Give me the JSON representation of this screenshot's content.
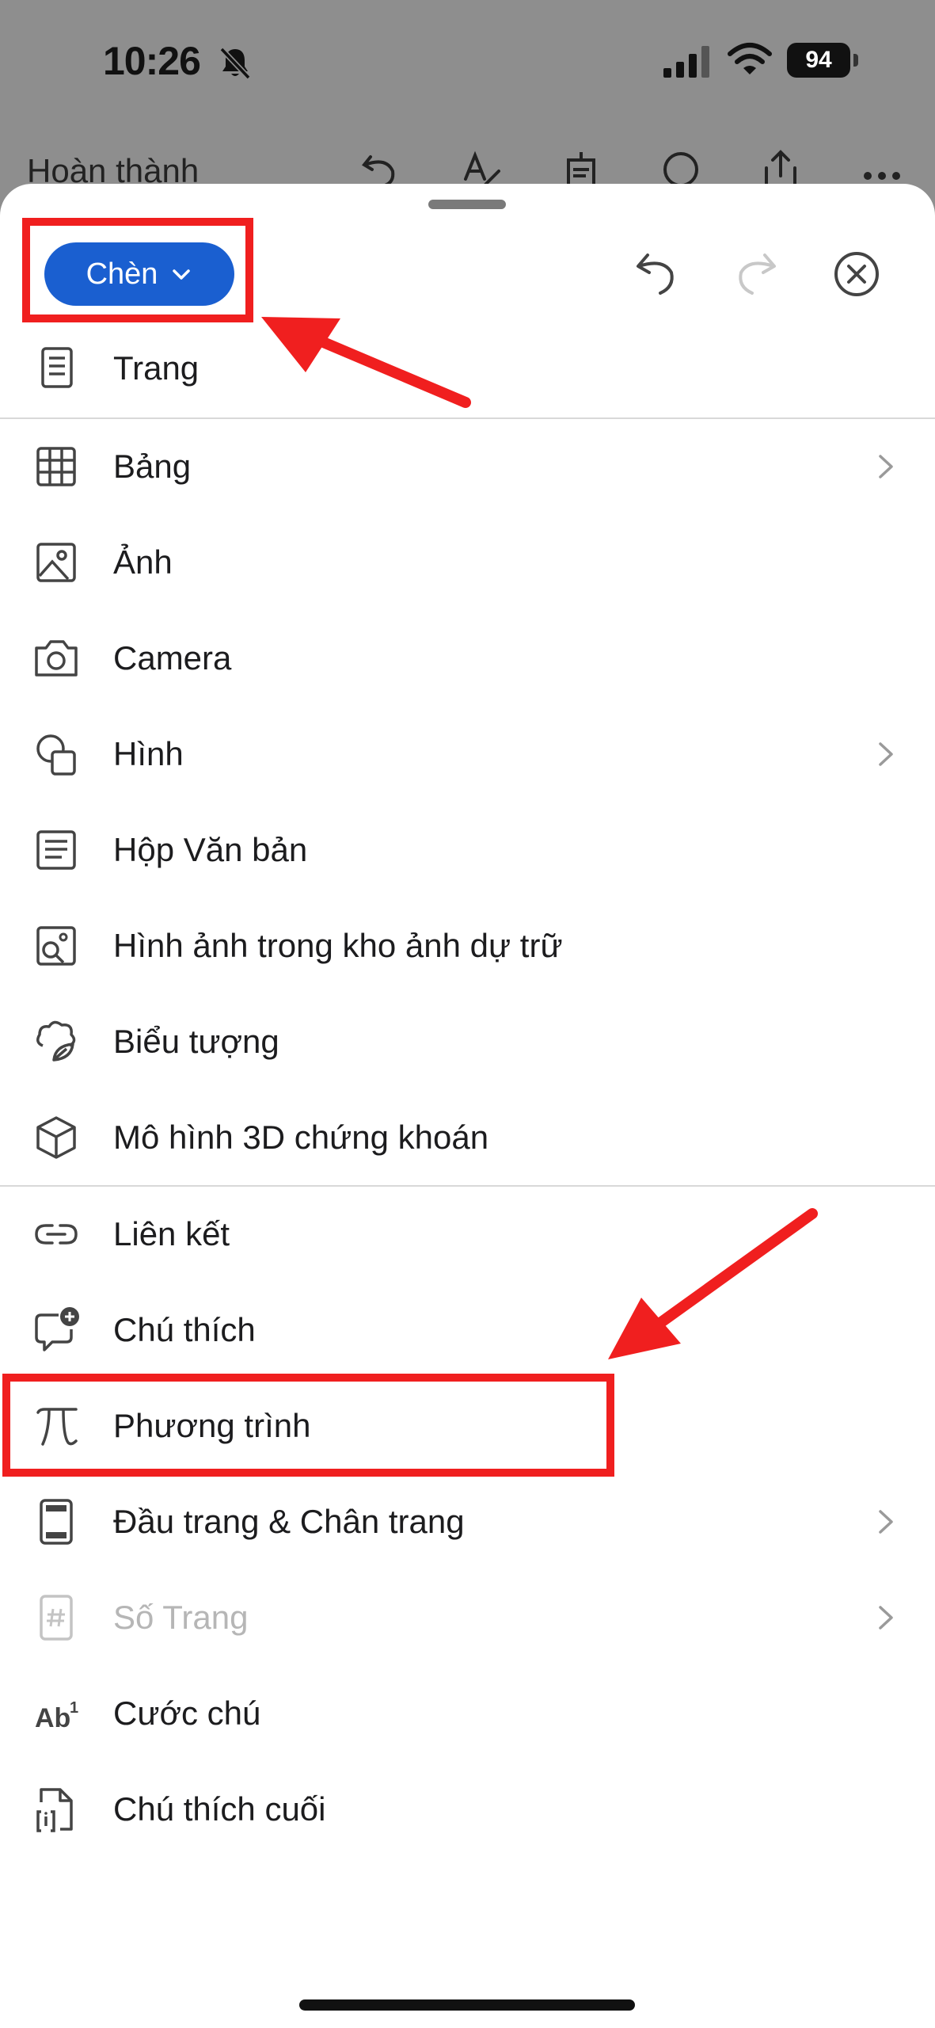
{
  "status_bar": {
    "time": "10:26",
    "battery": "94"
  },
  "background": {
    "done_label": "Hoàn thành"
  },
  "sheet": {
    "insert_label": "Chèn",
    "menu": [
      {
        "id": "page",
        "label": "Trang",
        "icon": "page-icon",
        "chevron": false
      },
      {
        "id": "table",
        "label": "Bảng",
        "icon": "table-icon",
        "chevron": true
      },
      {
        "id": "picture",
        "label": "Ảnh",
        "icon": "picture-icon",
        "chevron": false
      },
      {
        "id": "camera",
        "label": "Camera",
        "icon": "camera-icon",
        "chevron": false
      },
      {
        "id": "shape",
        "label": "Hình",
        "icon": "shape-icon",
        "chevron": true
      },
      {
        "id": "textbox",
        "label": "Hộp Văn bản",
        "icon": "textbox-icon",
        "chevron": false
      },
      {
        "id": "stock-images",
        "label": "Hình ảnh trong kho ảnh dự trữ",
        "icon": "stock-image-icon",
        "chevron": false
      },
      {
        "id": "icons",
        "label": "Biểu tượng",
        "icon": "icons-icon",
        "chevron": false
      },
      {
        "id": "3d-models",
        "label": "Mô hình 3D chứng khoán",
        "icon": "cube-icon",
        "chevron": false
      },
      {
        "id": "link",
        "label": "Liên kết",
        "icon": "link-icon",
        "chevron": false
      },
      {
        "id": "comment",
        "label": "Chú thích",
        "icon": "comment-add-icon",
        "chevron": false
      },
      {
        "id": "equation",
        "label": "Phương trình",
        "icon": "pi-icon",
        "chevron": false
      },
      {
        "id": "header-footer",
        "label": "Đầu trang & Chân trang",
        "icon": "header-footer-icon",
        "chevron": true
      },
      {
        "id": "page-number",
        "label": "Số Trang",
        "icon": "page-number-icon",
        "chevron": true,
        "disabled": true
      },
      {
        "id": "footnote",
        "label": "Cước chú",
        "icon": "footnote-icon",
        "chevron": false
      },
      {
        "id": "endnote",
        "label": "Chú thích cuối",
        "icon": "endnote-icon",
        "chevron": false
      }
    ]
  },
  "colors": {
    "accent": "#1a5fd0",
    "highlight": "#f01f1f",
    "disabled": "#b6b6b6"
  }
}
